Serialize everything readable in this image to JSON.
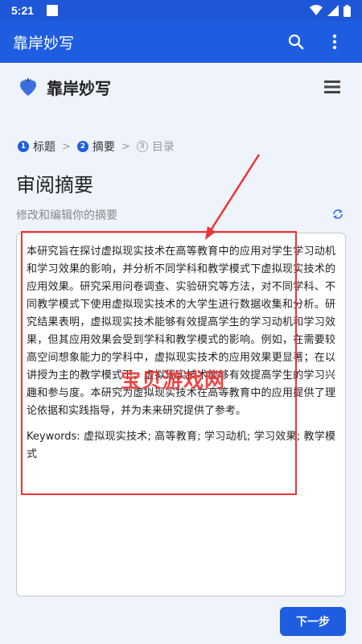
{
  "status_bar": {
    "time": "5:21"
  },
  "app_bar": {
    "title": "靠岸妙写",
    "search_icon": "search-icon",
    "more_icon": "more-vert-icon"
  },
  "brand": {
    "name": "靠岸妙写",
    "logo_icon": "heart-logo-icon",
    "menu_icon": "hamburger-menu-icon"
  },
  "steps": [
    {
      "number": "1",
      "label": "标题",
      "state": "done"
    },
    {
      "number": "2",
      "label": "摘要",
      "state": "active"
    },
    {
      "number": "3",
      "label": "目录",
      "state": "pending"
    }
  ],
  "page": {
    "title": "审阅摘要",
    "subtitle": "修改和编辑你的摘要",
    "refresh_icon": "refresh-icon"
  },
  "abstract": {
    "body": "本研究旨在探讨虚拟现实技术在高等教育中的应用对学生学习动机和学习效果的影响，并分析不同学科和教学模式下虚拟现实技术的应用效果。研究采用问卷调查、实验研究等方法，对不同学科、不同教学模式下使用虚拟现实技术的大学生进行数据收集和分析。研究结果表明，虚拟现实技术能够有效提高学生的学习动机和学习效果，但其应用效果会受到学科和教学模式的影响。例如，在需要较高空间想象能力的学科中，虚拟现实技术的应用效果更显著；在以讲授为主的教学模式下，虚拟现实技术能够有效提高学生的学习兴趣和参与度。本研究为虚拟现实技术在高等教育中的应用提供了理论依据和实践指导，并为未来研究提供了参考。",
    "keywords": "Keywords: 虚拟现实技术; 高等教育; 学习动机; 学习效果; 教学模式"
  },
  "watermark": "宝贝游戏网",
  "next_button": {
    "label": "下一步"
  },
  "colors": {
    "primary": "#1f5de0",
    "annotation": "#e33333",
    "background": "#eff3fb"
  }
}
